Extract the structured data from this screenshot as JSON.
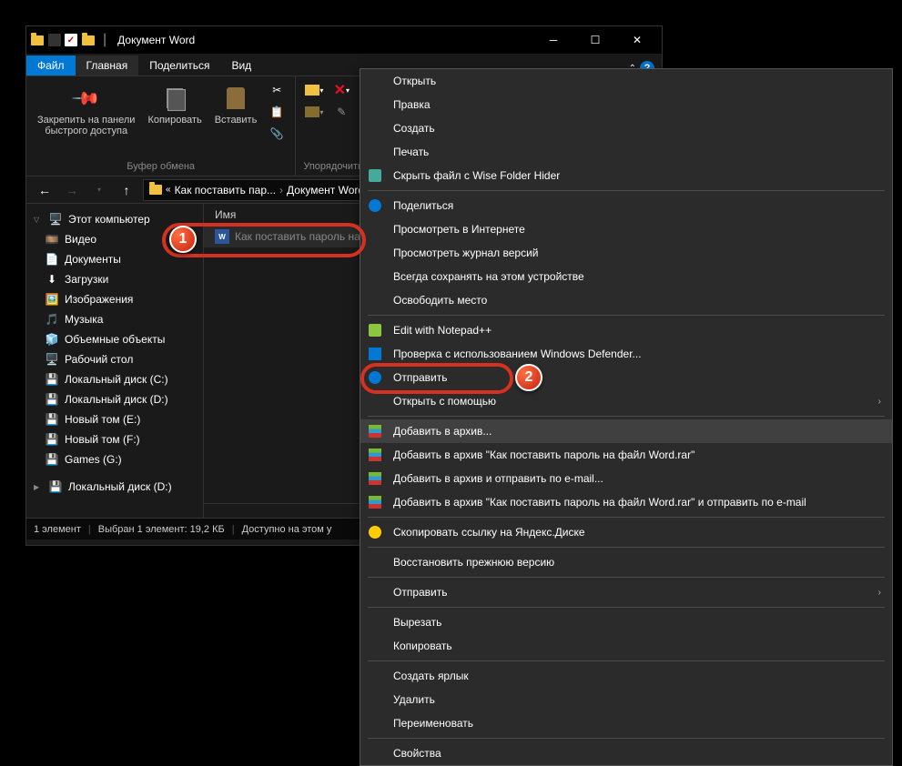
{
  "titlebar": {
    "title": "Документ Word"
  },
  "win_controls": {
    "minimize": "─",
    "maximize": "☐",
    "close": "✕"
  },
  "ribbon_tabs": {
    "file": "Файл",
    "home": "Главная",
    "share": "Поделиться",
    "view": "Вид"
  },
  "ribbon": {
    "pin": "Закрепить на панели\nбыстрого доступа",
    "copy": "Копировать",
    "paste": "Вставить",
    "clipboard_label": "Буфер обмена",
    "organize_label": "Упорядочить"
  },
  "nav": {
    "breadcrumb": {
      "part1": "Как поставить пар...",
      "part2": "Документ Word",
      "sep": "›"
    }
  },
  "sidebar": {
    "items": [
      {
        "label": "Этот компьютер",
        "icon": "🖥️",
        "top": true
      },
      {
        "label": "Видео",
        "icon": "🎞️"
      },
      {
        "label": "Документы",
        "icon": "📄"
      },
      {
        "label": "Загрузки",
        "icon": "⬇"
      },
      {
        "label": "Изображения",
        "icon": "🖼️"
      },
      {
        "label": "Музыка",
        "icon": "🎵"
      },
      {
        "label": "Объемные объекты",
        "icon": "🧊"
      },
      {
        "label": "Рабочий стол",
        "icon": "🖥️"
      },
      {
        "label": "Локальный диск (C:)",
        "icon": "💾"
      },
      {
        "label": "Локальный диск (D:)",
        "icon": "💾"
      },
      {
        "label": "Новый том (E:)",
        "icon": "💾"
      },
      {
        "label": "Новый том (F:)",
        "icon": "💾"
      },
      {
        "label": "Games (G:)",
        "icon": "💾"
      }
    ],
    "spacer_item": {
      "label": "Локальный диск (D:)",
      "icon": "💾"
    }
  },
  "file_list": {
    "col_name": "Имя",
    "file_name": "Как поставить пароль на"
  },
  "status": {
    "count": "1 элемент",
    "selected": "Выбран 1 элемент: 19,2 КБ",
    "available": "Доступно на этом у"
  },
  "context_menu": {
    "items": [
      {
        "label": "Открыть",
        "type": "item"
      },
      {
        "label": "Правка",
        "type": "item"
      },
      {
        "label": "Создать",
        "type": "item"
      },
      {
        "label": "Печать",
        "type": "item"
      },
      {
        "label": "Скрыть файл с Wise Folder Hider",
        "type": "item",
        "icon": "wise"
      },
      {
        "type": "sep"
      },
      {
        "label": "Поделиться",
        "type": "item",
        "icon": "share"
      },
      {
        "label": "Просмотреть в Интернете",
        "type": "item"
      },
      {
        "label": "Просмотреть журнал версий",
        "type": "item"
      },
      {
        "label": "Всегда сохранять на этом устройстве",
        "type": "item"
      },
      {
        "label": "Освободить место",
        "type": "item"
      },
      {
        "type": "sep"
      },
      {
        "label": "Edit with Notepad++",
        "type": "item",
        "icon": "notepad"
      },
      {
        "label": "Проверка с использованием Windows Defender...",
        "type": "item",
        "icon": "defender"
      },
      {
        "label": "Отправить",
        "type": "item",
        "icon": "share"
      },
      {
        "label": "Открыть с помощью",
        "type": "item",
        "arrow": true
      },
      {
        "type": "sep"
      },
      {
        "label": "Добавить в архив...",
        "type": "item",
        "icon": "rar",
        "highlighted": true
      },
      {
        "label": "Добавить в архив \"Как поставить пароль на файл Word.rar\"",
        "type": "item",
        "icon": "rar"
      },
      {
        "label": "Добавить в архив и отправить по e-mail...",
        "type": "item",
        "icon": "rar"
      },
      {
        "label": "Добавить в архив \"Как поставить пароль на файл Word.rar\" и отправить по e-mail",
        "type": "item",
        "icon": "rar"
      },
      {
        "type": "sep"
      },
      {
        "label": "Скопировать ссылку на Яндекс.Диске",
        "type": "item",
        "icon": "yadisk"
      },
      {
        "type": "sep"
      },
      {
        "label": "Восстановить прежнюю версию",
        "type": "item"
      },
      {
        "type": "sep"
      },
      {
        "label": "Отправить",
        "type": "item",
        "arrow": true
      },
      {
        "type": "sep"
      },
      {
        "label": "Вырезать",
        "type": "item"
      },
      {
        "label": "Копировать",
        "type": "item"
      },
      {
        "type": "sep"
      },
      {
        "label": "Создать ярлык",
        "type": "item"
      },
      {
        "label": "Удалить",
        "type": "item"
      },
      {
        "label": "Переименовать",
        "type": "item"
      },
      {
        "type": "sep"
      },
      {
        "label": "Свойства",
        "type": "item"
      }
    ]
  },
  "badges": {
    "one": "1",
    "two": "2"
  }
}
